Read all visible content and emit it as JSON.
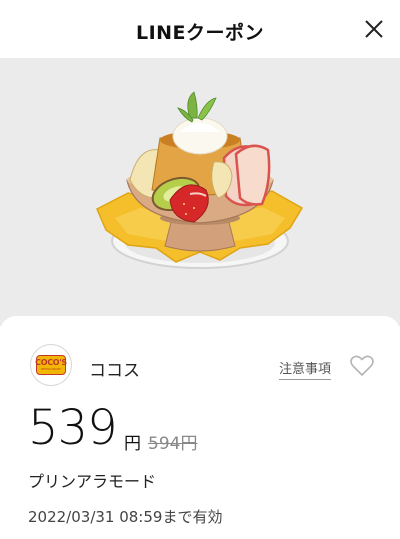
{
  "header": {
    "title": "LINEクーポン",
    "close_icon": "close-icon"
  },
  "hero": {
    "image": "pudding-a-la-mode-photo"
  },
  "coupon": {
    "store_logo_text": "COCO'S",
    "store_logo_subtext": "RESTAURANT",
    "store_name": "ココス",
    "notes_label": "注意事項",
    "favorite_icon": "heart-outline-icon",
    "price": "539",
    "price_unit": "円",
    "original_price": "594円",
    "product_name": "プリンアラモード",
    "expiry": "2022/03/31 08:59まで有効"
  },
  "colors": {
    "card_background": "#ffffff",
    "hero_background": "#ebebeb",
    "logo_yellow": "#f2b705",
    "logo_red": "#c0392b"
  }
}
